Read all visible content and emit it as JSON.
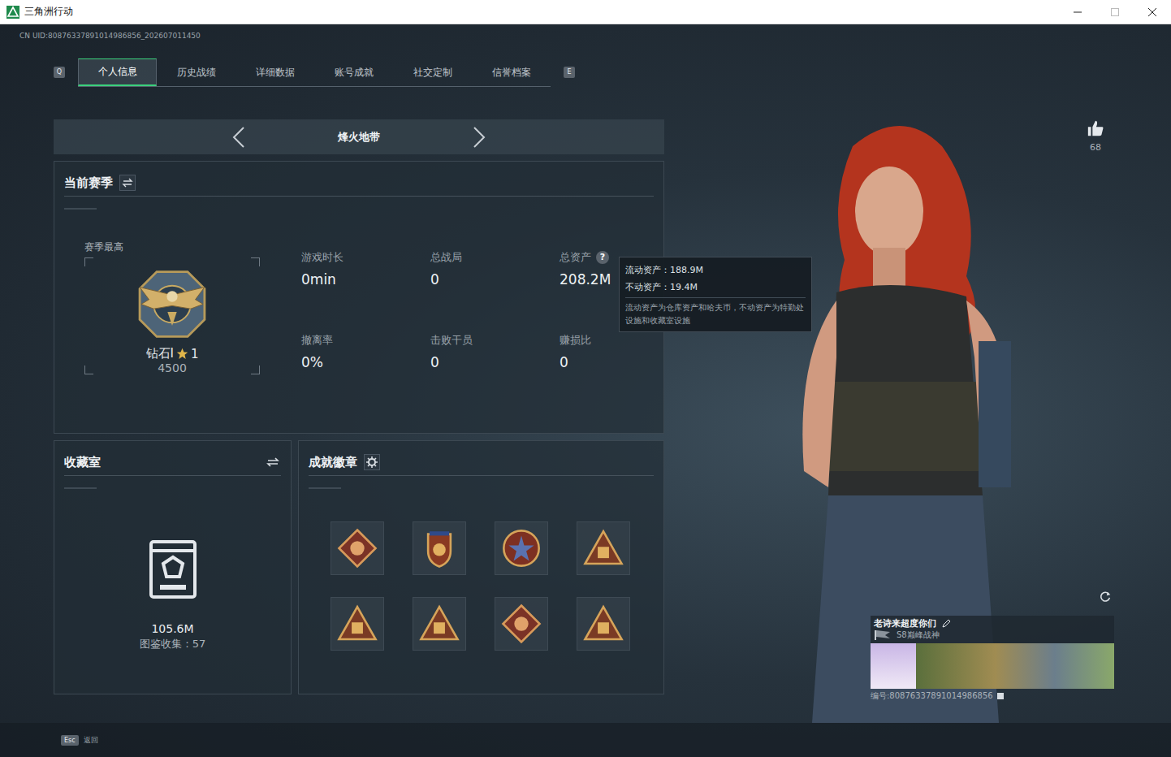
{
  "window": {
    "title": "三角洲行动"
  },
  "uid": "CN UID:80876337891014986856_202607011450",
  "tabs": {
    "prev_key": "Q",
    "next_key": "E",
    "items": [
      {
        "label": "个人信息",
        "selected": true
      },
      {
        "label": "历史战绩",
        "selected": false
      },
      {
        "label": "详细数据",
        "selected": false
      },
      {
        "label": "账号成就",
        "selected": false
      },
      {
        "label": "社交定制",
        "selected": false
      },
      {
        "label": "信誉档案",
        "selected": false
      }
    ]
  },
  "mode": {
    "label": "烽火地带"
  },
  "season": {
    "title": "当前赛季",
    "best_label": "赛季最高",
    "rank": "钻石I",
    "rank_stars": "1",
    "score": "4500",
    "stats": [
      {
        "label": "游戏时长",
        "value": "0min",
        "help": false
      },
      {
        "label": "总战局",
        "value": "0",
        "help": false
      },
      {
        "label": "总资产",
        "value": "208.2M",
        "help": true
      },
      {
        "label": "撤离率",
        "value": "0%",
        "help": false
      },
      {
        "label": "击败干员",
        "value": "0",
        "help": false
      },
      {
        "label": "赚损比",
        "value": "0",
        "help": false
      }
    ]
  },
  "help_icon": "?",
  "tooltip": {
    "lines": [
      "流动资产：188.9M",
      "不动资产：19.4M"
    ],
    "note": "流动资产为仓库资产和哈夫币，不动资产为特勤处设施和收藏室设施"
  },
  "collection": {
    "title": "收藏室",
    "value": "105.6M",
    "caption": "图鉴收集：57"
  },
  "achievements": {
    "title": "成就徽章"
  },
  "likes": "68",
  "card": {
    "name": "老诗来超度你们",
    "title": "S8巅峰战神",
    "id": "编号:80876337891014986856"
  },
  "footer": {
    "key": "Esc",
    "label": "返回"
  }
}
